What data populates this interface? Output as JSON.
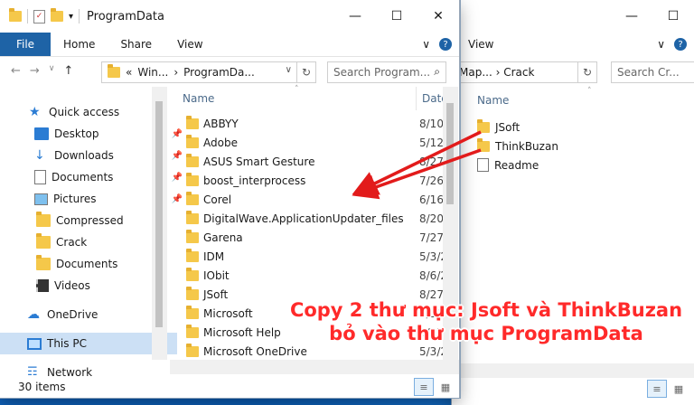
{
  "front": {
    "title": "ProgramData",
    "ribbon_tabs": [
      "File",
      "Home",
      "Share",
      "View"
    ],
    "address_prefix": "«",
    "address_crumbs": [
      "Win...",
      "›",
      "ProgramDa..."
    ],
    "search_placeholder": "Search Program...",
    "nav": [
      {
        "label": "Quick access",
        "icon": "star-icon",
        "pinned": false,
        "selected": false
      },
      {
        "label": "Desktop",
        "icon": "desktop-icon",
        "pinned": true,
        "selected": false
      },
      {
        "label": "Downloads",
        "icon": "download-icon",
        "pinned": true,
        "selected": false
      },
      {
        "label": "Documents",
        "icon": "documents-icon",
        "pinned": true,
        "selected": false
      },
      {
        "label": "Pictures",
        "icon": "pictures-icon",
        "pinned": true,
        "selected": false
      },
      {
        "label": "Compressed",
        "icon": "folder-icon",
        "pinned": false,
        "selected": false
      },
      {
        "label": "Crack",
        "icon": "folder-icon",
        "pinned": false,
        "selected": false
      },
      {
        "label": "Documents",
        "icon": "folder-icon",
        "pinned": false,
        "selected": false
      },
      {
        "label": "Videos",
        "icon": "videos-icon",
        "pinned": false,
        "selected": false
      },
      {
        "label": "OneDrive",
        "icon": "cloud-icon",
        "pinned": false,
        "selected": false
      },
      {
        "label": "This PC",
        "icon": "pc-icon",
        "pinned": false,
        "selected": true
      },
      {
        "label": "Network",
        "icon": "network-icon",
        "pinned": false,
        "selected": false
      }
    ],
    "col_name": "Name",
    "col_date": "Date",
    "files": [
      {
        "name": "ABBYY",
        "date": "8/10/"
      },
      {
        "name": "Adobe",
        "date": "5/12/"
      },
      {
        "name": "ASUS Smart Gesture",
        "date": "8/27/"
      },
      {
        "name": "boost_interprocess",
        "date": "7/26/"
      },
      {
        "name": "Corel",
        "date": "6/16/"
      },
      {
        "name": "DigitalWave.ApplicationUpdater_files",
        "date": "8/20/"
      },
      {
        "name": "Garena",
        "date": "7/27/"
      },
      {
        "name": "IDM",
        "date": "5/3/2"
      },
      {
        "name": "IObit",
        "date": "8/6/2"
      },
      {
        "name": "JSoft",
        "date": "8/27/"
      },
      {
        "name": "Microsoft",
        "date": "5/13/"
      },
      {
        "name": "Microsoft Help",
        "date": "8/27/"
      },
      {
        "name": "Microsoft OneDrive",
        "date": "5/3/2"
      }
    ],
    "status": "30 items"
  },
  "back": {
    "ribbon_view": "View",
    "address": "Map... › Crack",
    "search_placeholder": "Search Cr...",
    "col_name": "Name",
    "files": [
      {
        "name": "JSoft",
        "type": "folder"
      },
      {
        "name": "ThinkBuzan",
        "type": "folder"
      },
      {
        "name": "Readme",
        "type": "file"
      }
    ]
  },
  "caption": {
    "line1": "Copy 2 thư mục: Jsoft và ThinkBuzan",
    "line2": "bỏ vào thư mục ProgramData"
  },
  "colors": {
    "accent": "#1e63a6",
    "annotation": "#ff2a2a",
    "folder": "#f5c84a"
  }
}
